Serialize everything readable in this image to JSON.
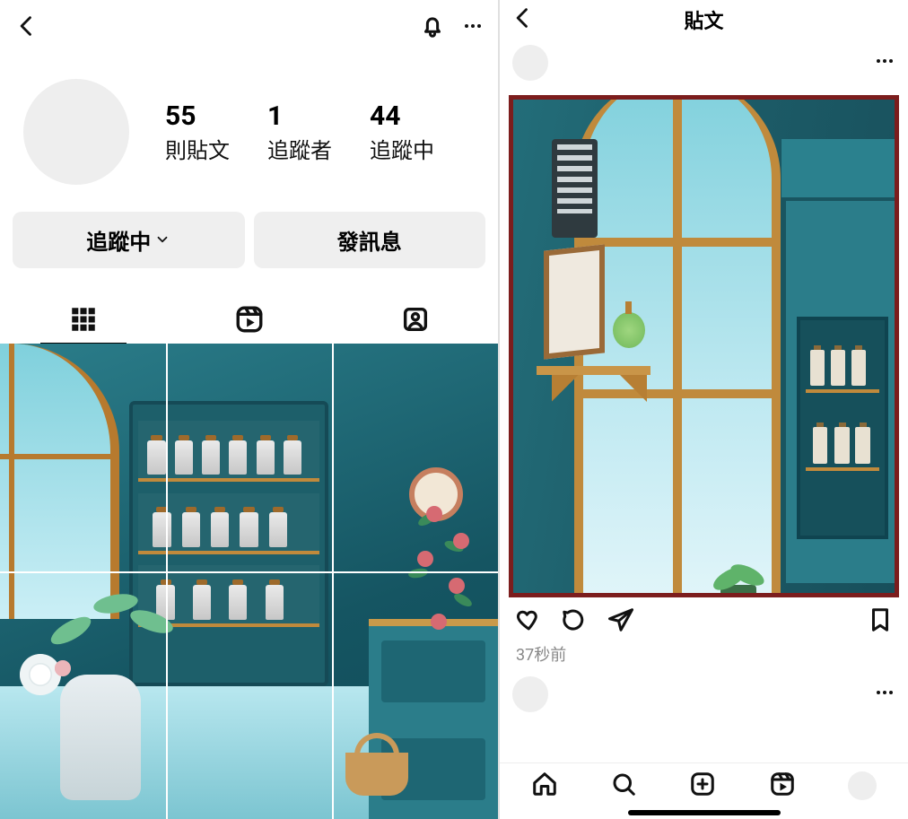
{
  "left": {
    "stats": {
      "posts_count": "55",
      "posts_label": "則貼文",
      "followers_count": "1",
      "followers_label": "追蹤者",
      "following_count": "44",
      "following_label": "追蹤中"
    },
    "actions": {
      "following_btn": "追蹤中",
      "message_btn": "發訊息"
    }
  },
  "right": {
    "header_title": "貼文",
    "timestamp": "37秒前"
  }
}
